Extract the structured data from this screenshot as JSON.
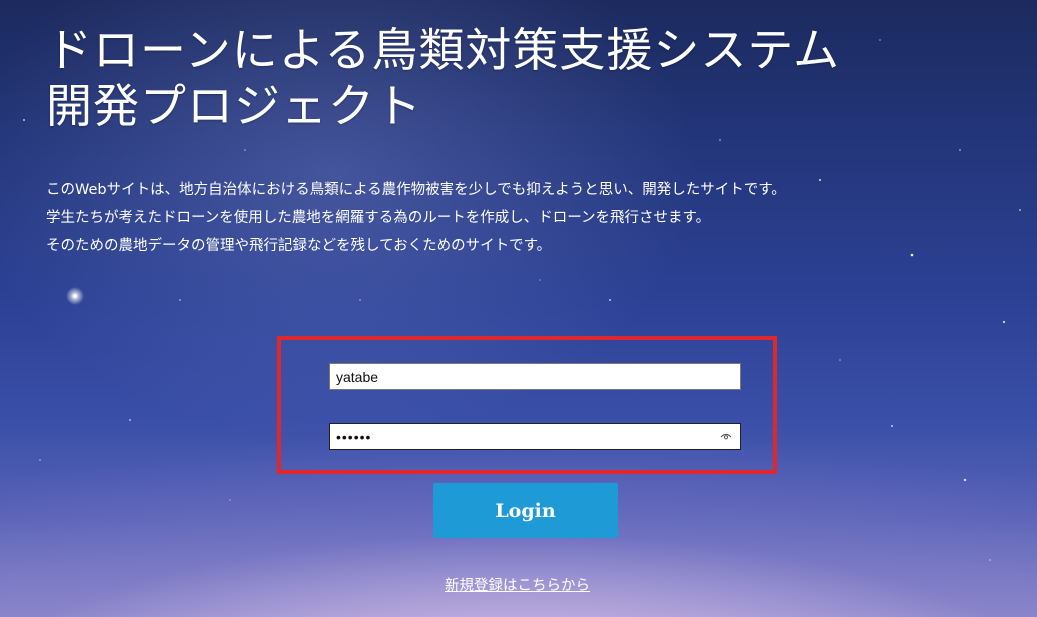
{
  "header": {
    "title_line1": "ドローンによる鳥類対策支援システム",
    "title_line2": "開発プロジェクト"
  },
  "description": {
    "line1": "このWebサイトは、地方自治体における鳥類による農作物被害を少しでも抑えようと思い、開発したサイトです。",
    "line2": "学生たちが考えたドローンを使用した農地を網羅する為のルートを作成し、ドローンを飛行させます。",
    "line3": "そのための農地データの管理や飛行記録などを残しておくためのサイトです。"
  },
  "login_form": {
    "username_value": "yatabe",
    "password_value": "••••••",
    "login_label": "Login",
    "register_link": "新規登録はこちらから"
  },
  "icons": {
    "password_reveal": "eye-icon"
  },
  "colors": {
    "highlight_border": "#e0272d",
    "login_button": "#1e9bd6"
  }
}
